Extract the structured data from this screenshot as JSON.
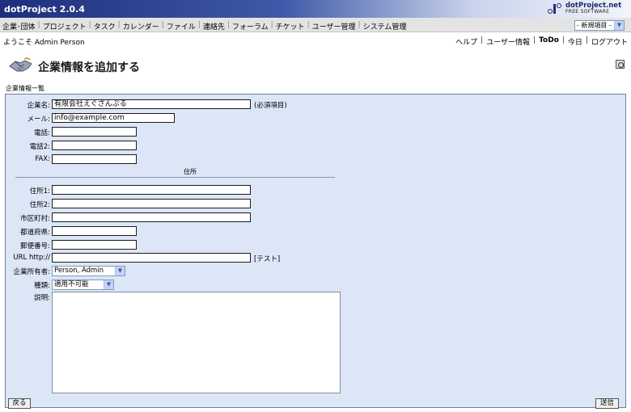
{
  "app": {
    "title": "dotProject 2.0.4",
    "logo_name": "dotProject.net",
    "logo_sub": "FREE SOFTWARE"
  },
  "nav": {
    "items": [
      "企業･団体",
      "プロジェクト",
      "タスク",
      "カレンダー",
      "ファイル",
      "連絡先",
      "フォーラム",
      "チケット",
      "ユーザー管理",
      "システム管理"
    ],
    "new_item": "- 新規項目 -"
  },
  "welcome": "ようこそ Admin Person",
  "toplinks": [
    "ヘルプ",
    "ユーザー情報",
    "ToDo",
    "今日",
    "ログアウト"
  ],
  "page": {
    "title": "企業情報を追加する",
    "breadcrumb": "企業情報一覧"
  },
  "form": {
    "company_name": {
      "label": "企業名:",
      "value": "有限会社えぐざんぷる",
      "note": "(必須項目)"
    },
    "email": {
      "label": "メール:",
      "value": "info@example.com"
    },
    "phone1": {
      "label": "電話:",
      "value": ""
    },
    "phone2": {
      "label": "電話2:",
      "value": ""
    },
    "fax": {
      "label": "FAX:",
      "value": ""
    },
    "address_section": "住所",
    "address1": {
      "label": "住所1:",
      "value": ""
    },
    "address2": {
      "label": "住所2:",
      "value": ""
    },
    "city": {
      "label": "市区町村:",
      "value": ""
    },
    "state": {
      "label": "都道府県:",
      "value": ""
    },
    "zip": {
      "label": "郵便番号:",
      "value": ""
    },
    "url": {
      "label": "URL http://",
      "value": "",
      "test_link": "[テスト]"
    },
    "owner": {
      "label": "企業所有者:",
      "value": "Person, Admin"
    },
    "type": {
      "label": "種類:",
      "value": "適用不可能"
    },
    "description": {
      "label": "説明:",
      "value": ""
    },
    "back_label": "戻る",
    "submit_label": "送信"
  }
}
